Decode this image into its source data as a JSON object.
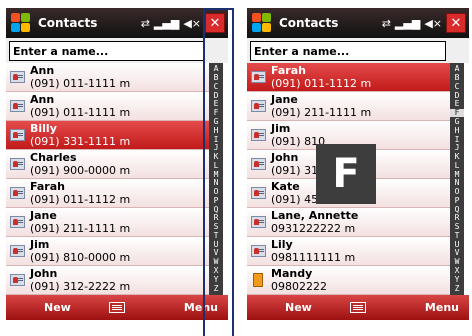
{
  "colors": {
    "titlebar": "#1a1a1a",
    "selected_row": "#d02424",
    "softbar": "#c02020",
    "index_bar": "#3c3c3c",
    "callout": "#1c2f6f"
  },
  "screens": [
    {
      "title": "Contacts",
      "status_icons": [
        "sync-icon",
        "signal-icon",
        "volume-icon"
      ],
      "close_label": "✕",
      "search_placeholder": "Enter a name...",
      "contacts": [
        {
          "name": "Ann",
          "phone": "(091) 011-1111  m",
          "icon": "contact-card-icon"
        },
        {
          "name": "Ann",
          "phone": "(091) 011-1111  m",
          "icon": "contact-card-icon"
        },
        {
          "name": "Billy",
          "phone": "(091) 331-1111  m",
          "icon": "contact-card-icon",
          "selected": true
        },
        {
          "name": "Charles",
          "phone": "(091) 900-0000  m",
          "icon": "contact-card-icon"
        },
        {
          "name": "Farah",
          "phone": "(091) 011-1112  m",
          "icon": "contact-card-icon"
        },
        {
          "name": "Jane",
          "phone": "(091) 211-1111  m",
          "icon": "contact-card-icon"
        },
        {
          "name": "Jim",
          "phone": "(091) 810-0000  m",
          "icon": "contact-card-icon"
        },
        {
          "name": "John",
          "phone": "(091) 312-2222  m",
          "icon": "contact-card-icon"
        }
      ],
      "alphabet": [
        "A",
        "B",
        "C",
        "D",
        "E",
        "F",
        "G",
        "H",
        "I",
        "J",
        "K",
        "L",
        "M",
        "N",
        "O",
        "P",
        "Q",
        "R",
        "S",
        "T",
        "U",
        "V",
        "W",
        "X",
        "Y",
        "Z"
      ],
      "active_letter": "",
      "softkeys": {
        "left": "New",
        "right": "Menu"
      },
      "overlay_letter": ""
    },
    {
      "title": "Contacts",
      "status_icons": [
        "sync-icon",
        "signal-icon",
        "volume-icon"
      ],
      "close_label": "✕",
      "search_placeholder": "Enter a name...",
      "contacts": [
        {
          "name": "Farah",
          "phone": "(091) 011-1112  m",
          "icon": "contact-card-icon",
          "selected": true
        },
        {
          "name": "Jane",
          "phone": "(091) 211-1111  m",
          "icon": "contact-card-icon"
        },
        {
          "name": "Jim",
          "phone": "(091) 810",
          "icon": "contact-card-icon"
        },
        {
          "name": "John",
          "phone": "(091) 312",
          "icon": "contact-card-icon"
        },
        {
          "name": "Kate",
          "phone": "(091) 450",
          "icon": "contact-card-icon"
        },
        {
          "name": "Lane, Annette",
          "phone": "0931222222  m",
          "icon": "contact-card-icon"
        },
        {
          "name": "Lily",
          "phone": "0981111111  m",
          "icon": "contact-card-icon"
        },
        {
          "name": "Mandy",
          "phone": "09802222",
          "icon": "document-icon"
        }
      ],
      "alphabet": [
        "A",
        "B",
        "C",
        "D",
        "E",
        "F",
        "G",
        "H",
        "I",
        "J",
        "K",
        "L",
        "M",
        "N",
        "O",
        "P",
        "Q",
        "R",
        "S",
        "T",
        "U",
        "V",
        "W",
        "X",
        "Y",
        "Z"
      ],
      "active_letter": "F",
      "softkeys": {
        "left": "New",
        "right": "Menu"
      },
      "overlay_letter": "F"
    }
  ]
}
